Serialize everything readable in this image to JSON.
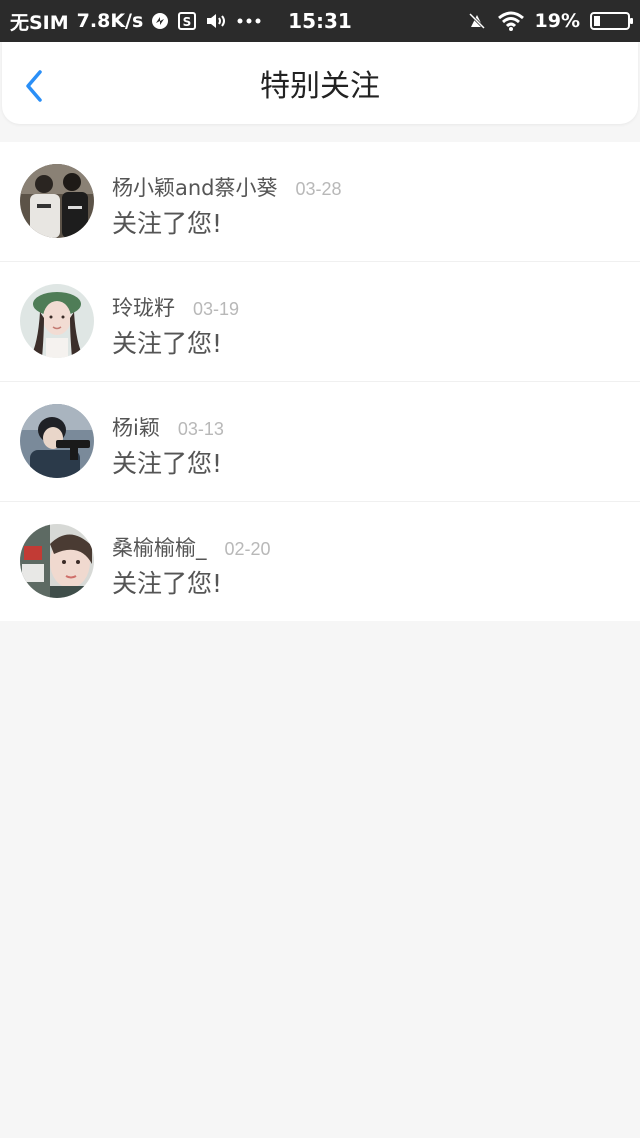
{
  "status_bar": {
    "carrier": "无SIM",
    "speed": "7.8K/s",
    "time": "15:31",
    "battery": "19%",
    "battery_level": 0.19,
    "icons": [
      "data-saver-icon",
      "screenshot-icon",
      "volume-icon",
      "more-icon",
      "mute-icon",
      "wifi-icon",
      "battery-icon"
    ]
  },
  "nav": {
    "title": "特别关注",
    "back_icon": "chevron-left-icon",
    "accent": "#2a8ff7"
  },
  "notifications": [
    {
      "name": "杨小颖and蔡小葵",
      "date": "03-28",
      "message": "关注了您!"
    },
    {
      "name": "玲珑籽",
      "date": "03-19",
      "message": "关注了您!"
    },
    {
      "name": "杨i颖",
      "date": "03-13",
      "message": "关注了您!"
    },
    {
      "name": "桑榆榆榆_",
      "date": "02-20",
      "message": "关注了您!"
    }
  ]
}
